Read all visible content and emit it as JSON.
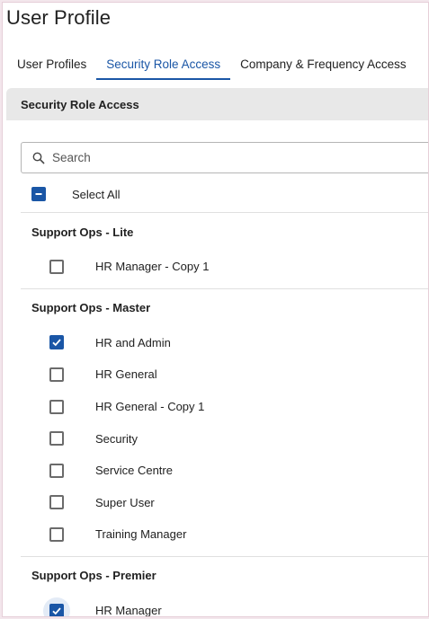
{
  "page_title": "User Profile",
  "tabs": [
    {
      "label": "User Profiles",
      "active": false
    },
    {
      "label": "Security Role Access",
      "active": true
    },
    {
      "label": "Company & Frequency Access",
      "active": false
    }
  ],
  "section": {
    "title": "Security Role Access"
  },
  "search": {
    "placeholder": "Search",
    "value": ""
  },
  "select_all": {
    "label": "Select All",
    "state": "indeterminate"
  },
  "groups": [
    {
      "title": "Support Ops - Lite",
      "items": [
        {
          "label": "HR Manager - Copy 1",
          "checked": false
        }
      ]
    },
    {
      "title": "Support Ops - Master",
      "items": [
        {
          "label": "HR and Admin",
          "checked": true
        },
        {
          "label": "HR General",
          "checked": false
        },
        {
          "label": "HR General - Copy 1",
          "checked": false
        },
        {
          "label": "Security",
          "checked": false
        },
        {
          "label": "Service Centre",
          "checked": false
        },
        {
          "label": "Super User",
          "checked": false
        },
        {
          "label": "Training Manager",
          "checked": false
        }
      ]
    },
    {
      "title": "Support Ops - Premier",
      "items": [
        {
          "label": "HR Manager",
          "checked": true,
          "focused": true
        }
      ]
    }
  ],
  "colors": {
    "accent": "#1a56a6",
    "section_bg": "#e8e8e8",
    "focus_ring": "#e3ebf6"
  }
}
